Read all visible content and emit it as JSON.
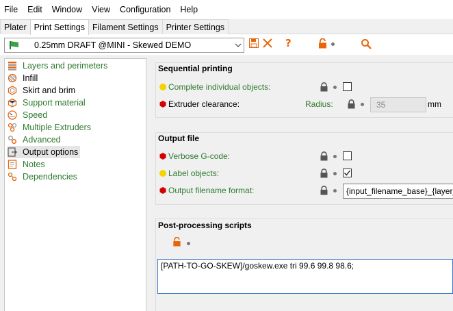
{
  "menubar": {
    "items": [
      "File",
      "Edit",
      "Window",
      "View",
      "Configuration",
      "Help"
    ]
  },
  "tabs": [
    "Plater",
    "Print Settings",
    "Filament Settings",
    "Printer Settings"
  ],
  "active_tab": "Print Settings",
  "toolbar": {
    "preset_name": "0.25mm DRAFT @MINI - Skewed DEMO",
    "icons": [
      "save-icon",
      "delete-icon",
      "help-icon",
      "unlock-icon",
      "search-icon"
    ],
    "colors": {
      "orange": "#e8650a",
      "green": "#3da04a"
    }
  },
  "sidebar": {
    "items": [
      {
        "label": "Layers and perimeters",
        "icon": "layers-icon",
        "modified": true
      },
      {
        "label": "Infill",
        "icon": "infill-icon",
        "modified": false
      },
      {
        "label": "Skirt and brim",
        "icon": "skirt-icon",
        "modified": false
      },
      {
        "label": "Support material",
        "icon": "support-icon",
        "modified": true
      },
      {
        "label": "Speed",
        "icon": "speed-icon",
        "modified": true
      },
      {
        "label": "Multiple Extruders",
        "icon": "extruders-icon",
        "modified": true
      },
      {
        "label": "Advanced",
        "icon": "advanced-icon",
        "modified": true
      },
      {
        "label": "Output options",
        "icon": "output-icon",
        "modified": false,
        "selected": true
      },
      {
        "label": "Notes",
        "icon": "notes-icon",
        "modified": true
      },
      {
        "label": "Dependencies",
        "icon": "dependencies-icon",
        "modified": true
      }
    ]
  },
  "sequential": {
    "title": "Sequential printing",
    "complete_label": "Complete individual objects:",
    "complete_checked": false,
    "clearance_label": "Extruder clearance:",
    "radius_label": "Radius:",
    "radius_value": "35",
    "radius_unit": "mm"
  },
  "output": {
    "title": "Output file",
    "verbose_label": "Verbose G-code:",
    "verbose_checked": false,
    "label_objects_label": "Label objects:",
    "label_objects_checked": true,
    "filename_label": "Output filename format:",
    "filename_value": "{input_filename_base}_{layer_"
  },
  "postprocess": {
    "title": "Post-processing scripts",
    "script_value": "[PATH-TO-GO-SKEW]/goskew.exe tri 99.6 99.8 98.6;"
  }
}
